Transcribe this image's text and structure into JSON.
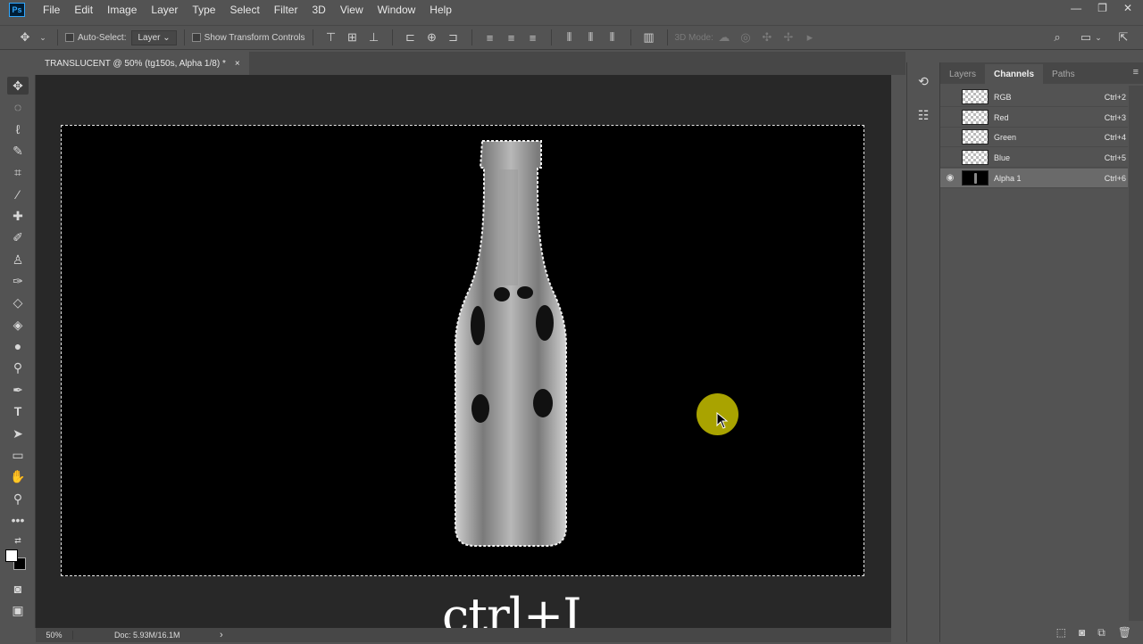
{
  "app_logo": "Ps",
  "menu": [
    "File",
    "Edit",
    "Image",
    "Layer",
    "Type",
    "Select",
    "Filter",
    "3D",
    "View",
    "Window",
    "Help"
  ],
  "window_controls": {
    "minimize": "—",
    "restore": "❐",
    "close": "✕"
  },
  "options": {
    "auto_select_label": "Auto-Select:",
    "auto_select_target": "Layer",
    "show_transform_label": "Show Transform Controls",
    "mode_3d_label": "3D Mode:"
  },
  "document": {
    "tab_title": "TRANSLUCENT @ 50% (tg150s, Alpha 1/8) *",
    "close_glyph": "×"
  },
  "canvas": {
    "caption": "ctrl+I",
    "highlight_color": "#c7c000"
  },
  "status": {
    "zoom": "50%",
    "doc_info": "Doc: 5.93M/16.1M",
    "arrow": "›"
  },
  "panel": {
    "tabs": [
      "Layers",
      "Channels",
      "Paths"
    ],
    "active_tab": "Channels",
    "channels": [
      {
        "name": "RGB",
        "shortcut": "Ctrl+2",
        "visible": false
      },
      {
        "name": "Red",
        "shortcut": "Ctrl+3",
        "visible": false
      },
      {
        "name": "Green",
        "shortcut": "Ctrl+4",
        "visible": false
      },
      {
        "name": "Blue",
        "shortcut": "Ctrl+5",
        "visible": false
      },
      {
        "name": "Alpha 1",
        "shortcut": "Ctrl+6",
        "visible": true
      }
    ]
  }
}
